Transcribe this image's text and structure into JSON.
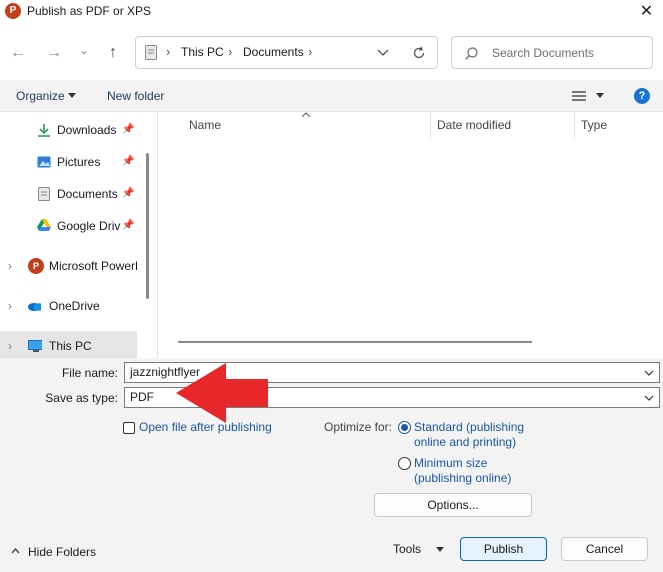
{
  "window": {
    "title": "Publish as PDF or XPS",
    "app_icon_letter": "P",
    "close_glyph": "✕"
  },
  "nav": {
    "back_glyph": "←",
    "forward_glyph": "→",
    "recent_glyph": "⌄",
    "up_glyph": "↑",
    "breadcrumb": [
      "This PC",
      "Documents"
    ],
    "sep_glyph": "›",
    "search_placeholder": "Search Documents"
  },
  "toolbar": {
    "organize_label": "Organize",
    "new_folder_label": "New folder",
    "help_glyph": "?"
  },
  "sidebar": {
    "items": [
      {
        "label": "Downloads",
        "icon": "download-icon",
        "pinned": true
      },
      {
        "label": "Pictures",
        "icon": "pictures-icon",
        "pinned": true
      },
      {
        "label": "Documents",
        "icon": "documents-icon",
        "pinned": true
      },
      {
        "label": "Google Drive",
        "icon": "google-drive-icon",
        "pinned": true
      },
      {
        "label": "Microsoft PowerPoint",
        "icon": "powerpoint-icon",
        "pinned": false
      },
      {
        "label": "OneDrive",
        "icon": "onedrive-icon",
        "pinned": false
      },
      {
        "label": "This PC",
        "icon": "this-pc-icon",
        "pinned": false
      }
    ],
    "pin_glyph": "📌",
    "expander_glyph": "›"
  },
  "columns": {
    "name": "Name",
    "date_modified": "Date modified",
    "type": "Type"
  },
  "form": {
    "file_name_label": "File name:",
    "file_name_value": "jazznightflyer",
    "save_type_label": "Save as type:",
    "save_type_value": "PDF",
    "open_after_label": "Open file after publishing",
    "optimize_label": "Optimize for:",
    "optimize_standard_line1": "Standard (publishing",
    "optimize_standard_line2": "online and printing)",
    "optimize_minimum_line1": "Minimum size",
    "optimize_minimum_line2": "(publishing online)",
    "options_label": "Options..."
  },
  "footer": {
    "hide_folders_label": "Hide Folders",
    "tools_label": "Tools",
    "publish_label": "Publish",
    "cancel_label": "Cancel"
  },
  "colors": {
    "accent": "#0067c0",
    "link": "#1a56a7",
    "arrow": "#e8272b",
    "powerpoint": "#c43e1c"
  }
}
